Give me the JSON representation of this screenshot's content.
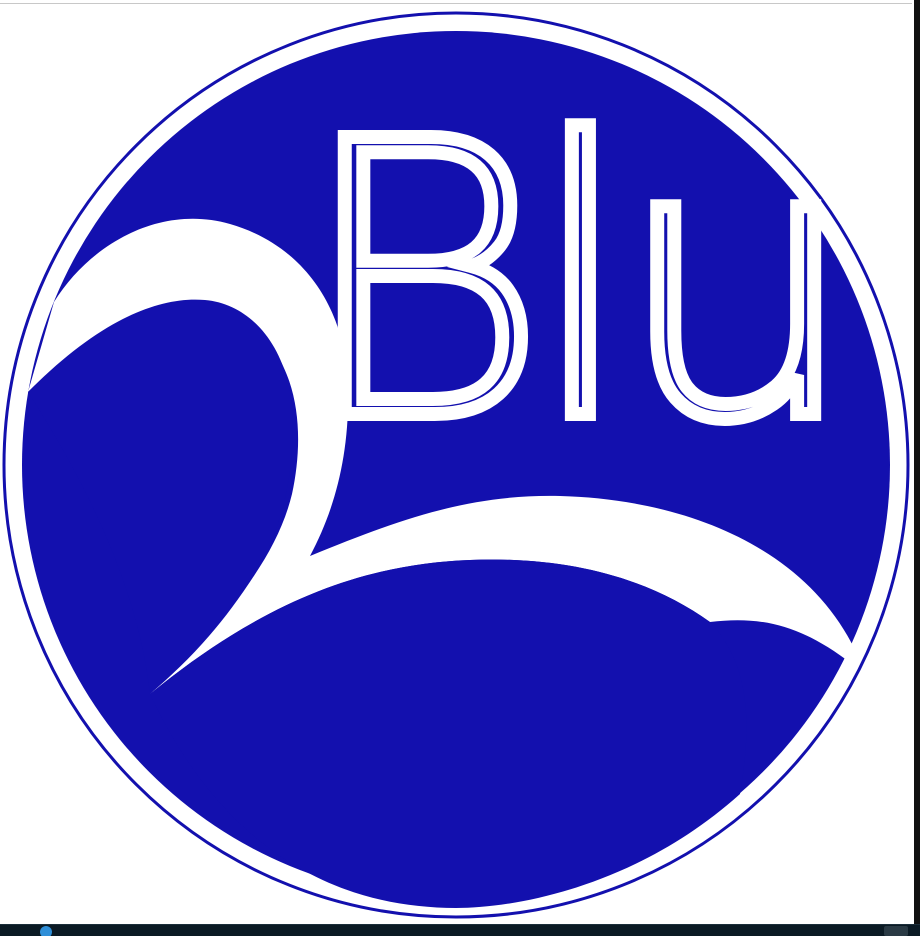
{
  "logo": {
    "wordmark": "Blu",
    "brand_color": "#1310AE",
    "background_color": "#FFFFFF",
    "icon": "blu-wave-logo"
  },
  "taskbar": {
    "start_icon": "start-orb-icon",
    "tray_icon": "tray-icon"
  }
}
